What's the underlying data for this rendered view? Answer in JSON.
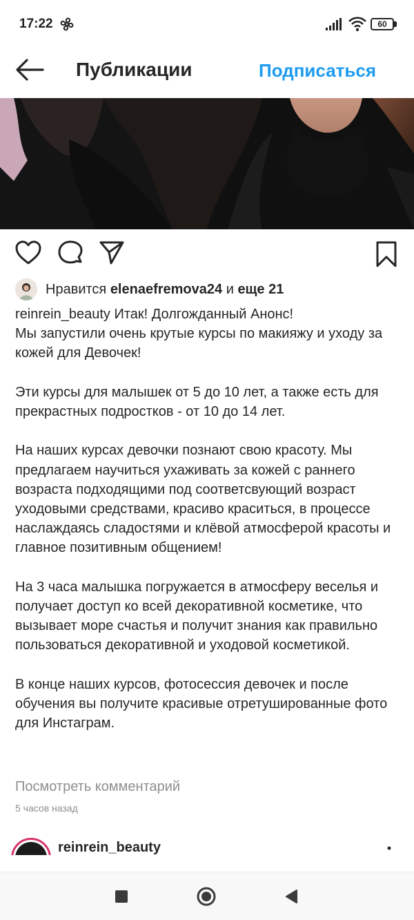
{
  "status_bar": {
    "time": "17:22",
    "battery": "60"
  },
  "header": {
    "title": "Публикации",
    "follow_label": "Подписаться"
  },
  "likes": {
    "prefix": "Нравится ",
    "user": "elenaefremova24",
    "conjunction": " и ",
    "others": "еще 21"
  },
  "caption": {
    "username": "reinrein_beauty",
    "paragraphs": [
      "Итак! Долгожданный Анонс!",
      "Мы запустили очень крутые курсы по макияжу и уходу за кожей для Девочек!",
      "",
      "Эти курсы для малышек от 5 до 10 лет, а также есть для прекрастных подростков - от 10 до 14 лет.",
      "",
      "На наших курсах девочки познают свою красоту. Мы предлагаем научиться ухаживать за кожей с раннего возраста подходящими под соответсвующий возраст уходовыми средствами, красиво краситься, в процессе наслаждаясь сладостями и клёвой атмосферой красоты и главное позитивным общением!",
      "",
      "На 3 часа малышка погружается в атмосферу веселья и получает доступ ко всей декоративной косметике, что вызывает море счастья и получит знания как правильно пользоваться декоративной и уходовой косметикой.",
      "",
      "В конце наших курсов, фотосессия девочек и после обучения вы получите красивые отретушированные фото для Инстаграм."
    ]
  },
  "view_comments": "Посмотреть комментарий",
  "timestamp": "5 часов назад",
  "next_post": {
    "username": "reinrein_beauty"
  },
  "colors": {
    "accent": "#1d9bf0",
    "text": "#262626",
    "muted": "#8e8e8e"
  },
  "icons": {
    "back": "arrow-left-icon",
    "like": "heart-icon",
    "comment": "comment-bubble-icon",
    "share": "paper-plane-icon",
    "save": "bookmark-icon",
    "nav_recent": "square-icon",
    "nav_home": "circle-icon",
    "nav_back": "triangle-back-icon"
  }
}
